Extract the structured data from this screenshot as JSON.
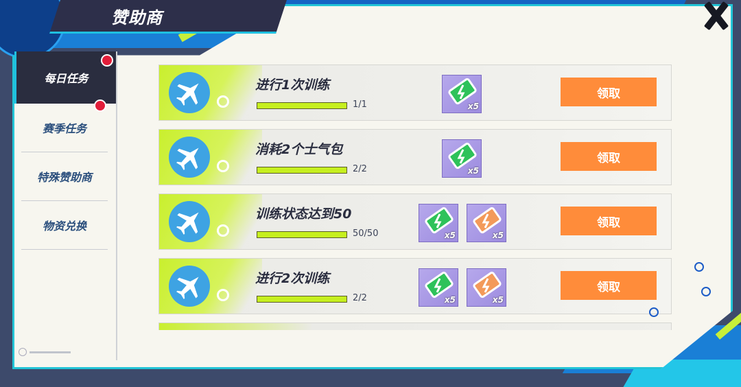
{
  "title": "赞助商",
  "sidebar": {
    "items": [
      {
        "label": "每日任务",
        "active": true,
        "badge": true
      },
      {
        "label": "赛季任务",
        "active": false,
        "badge": true
      },
      {
        "label": "特殊赞助商",
        "active": false,
        "badge": false
      },
      {
        "label": "物资兑换",
        "active": false,
        "badge": false
      }
    ]
  },
  "tasks": [
    {
      "name": "进行1次训练",
      "progress": "1/1",
      "fill": 1.0,
      "rewards": [
        {
          "icon": "green-energy-icon",
          "qty": "x5"
        }
      ],
      "button": "领取"
    },
    {
      "name": "消耗2个士气包",
      "progress": "2/2",
      "fill": 1.0,
      "rewards": [
        {
          "icon": "green-energy-icon",
          "qty": "x5"
        }
      ],
      "button": "领取"
    },
    {
      "name": "训练状态达到50",
      "progress": "50/50",
      "fill": 1.0,
      "rewards": [
        {
          "icon": "green-energy-icon",
          "qty": "x5"
        },
        {
          "icon": "orange-energy-icon",
          "qty": "x5"
        }
      ],
      "button": "领取"
    },
    {
      "name": "进行2次训练",
      "progress": "2/2",
      "fill": 1.0,
      "rewards": [
        {
          "icon": "green-energy-icon",
          "qty": "x5"
        },
        {
          "icon": "orange-energy-icon",
          "qty": "x5"
        }
      ],
      "button": "领取"
    }
  ],
  "colors": {
    "accent": "#22c4d6",
    "button": "#ff8c3a",
    "progress": "#c6ef1f",
    "sidebar_active": "#2a2d3f"
  }
}
